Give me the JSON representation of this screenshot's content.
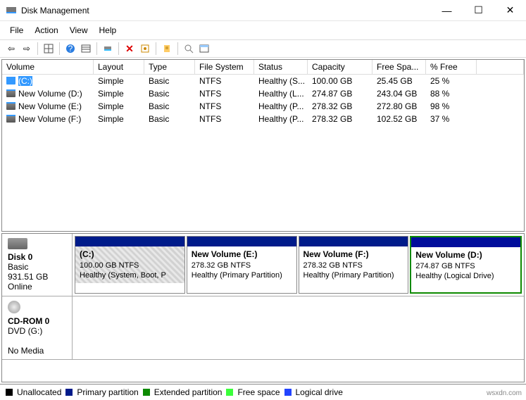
{
  "window": {
    "title": "Disk Management"
  },
  "menu": [
    "File",
    "Action",
    "View",
    "Help"
  ],
  "columns": [
    "Volume",
    "Layout",
    "Type",
    "File System",
    "Status",
    "Capacity",
    "Free Spa...",
    "% Free"
  ],
  "volumes": [
    {
      "name": "(C:)",
      "layout": "Simple",
      "type": "Basic",
      "fs": "NTFS",
      "status": "Healthy (S...",
      "capacity": "100.00 GB",
      "free": "25.45 GB",
      "pct": "25 %",
      "selected": true
    },
    {
      "name": "New Volume (D:)",
      "layout": "Simple",
      "type": "Basic",
      "fs": "NTFS",
      "status": "Healthy (L...",
      "capacity": "274.87 GB",
      "free": "243.04 GB",
      "pct": "88 %",
      "selected": false
    },
    {
      "name": "New Volume (E:)",
      "layout": "Simple",
      "type": "Basic",
      "fs": "NTFS",
      "status": "Healthy (P...",
      "capacity": "278.32 GB",
      "free": "272.80 GB",
      "pct": "98 %",
      "selected": false
    },
    {
      "name": "New Volume (F:)",
      "layout": "Simple",
      "type": "Basic",
      "fs": "NTFS",
      "status": "Healthy (P...",
      "capacity": "278.32 GB",
      "free": "102.52 GB",
      "pct": "37 %",
      "selected": false
    }
  ],
  "disk0": {
    "title": "Disk 0",
    "type": "Basic",
    "size": "931.51 GB",
    "status": "Online",
    "parts": [
      {
        "name": "(C:)",
        "size": "100.00 GB NTFS",
        "status": "Healthy (System, Boot, P",
        "cls": "primary sys"
      },
      {
        "name": "New Volume  (E:)",
        "size": "278.32 GB NTFS",
        "status": "Healthy (Primary Partition)",
        "cls": "primary"
      },
      {
        "name": "New Volume  (F:)",
        "size": "278.32 GB NTFS",
        "status": "Healthy (Primary Partition)",
        "cls": "primary"
      },
      {
        "name": "New Volume  (D:)",
        "size": "274.87 GB NTFS",
        "status": "Healthy (Logical Drive)",
        "cls": "ext"
      }
    ]
  },
  "cdrom": {
    "title": "CD-ROM 0",
    "type": "DVD (G:)",
    "status": "No Media"
  },
  "legend": {
    "unallocated": "Unallocated",
    "primary": "Primary partition",
    "extended": "Extended partition",
    "free": "Free space",
    "logical": "Logical drive"
  },
  "watermark": "wsxdn.com"
}
